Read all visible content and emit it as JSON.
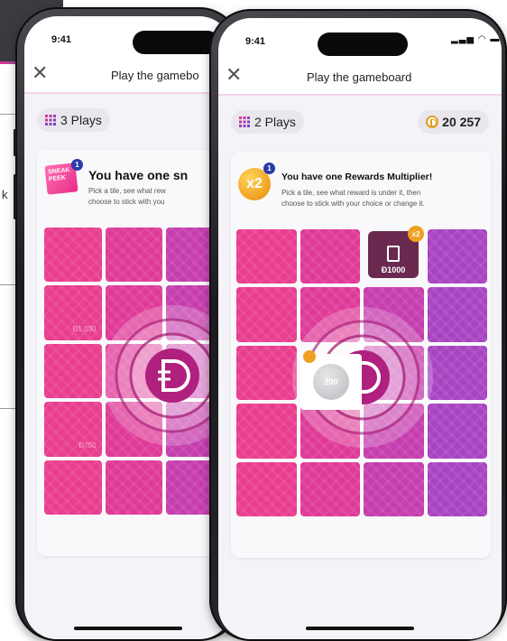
{
  "background_page": {
    "edge_letter": "k"
  },
  "phone_left": {
    "time": "9:41",
    "nav": {
      "close_icon": "close-icon",
      "title": "Play the gamebo"
    },
    "plays_chip": {
      "icon": "grid-icon",
      "label": "3 Plays"
    },
    "message": {
      "badge_text": "SNEAK PEEK",
      "badge_count": "1",
      "title": "You have one sn",
      "desc_line1": "Pick a tile, see what rew",
      "desc_line2": "choose to stick with you"
    },
    "tile_labels": [
      "Đ1,030",
      "Đ750"
    ]
  },
  "phone_right": {
    "time": "9:41",
    "status": "signal wifi battery",
    "nav": {
      "close_icon": "close-icon",
      "title": "Play the gameboard"
    },
    "plays_chip": {
      "icon": "grid-icon",
      "label": "2 Plays"
    },
    "balance_chip": {
      "icon": "coin-icon",
      "value": "20 257"
    },
    "message": {
      "badge_text": "x2",
      "badge_count": "1",
      "title": "You have one Rewards Multiplier!",
      "desc_line1": "Pick a tile, see what reward is under it, then",
      "desc_line2": "choose to stick with your choice or change it."
    },
    "revealed_fuel": {
      "amount": "Đ1000",
      "multiplier": "x2"
    },
    "revealed_coin": {
      "amount": "200"
    }
  },
  "colors": {
    "pink": "#e93d8e",
    "purple": "#a844c2",
    "gold": "#f0a020",
    "navy": "#2a3aa8"
  }
}
